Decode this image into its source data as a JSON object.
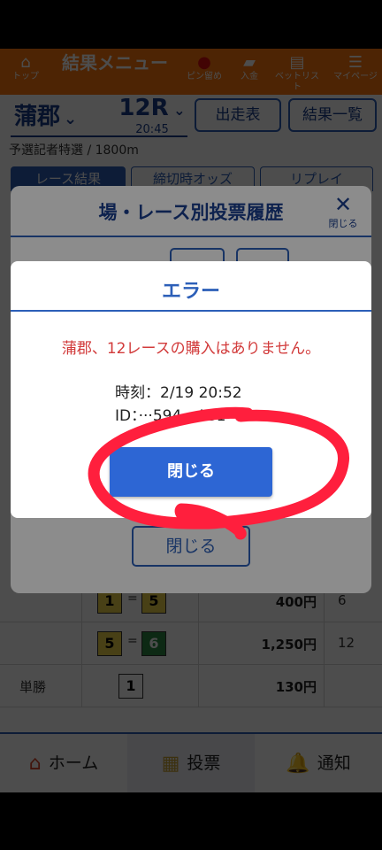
{
  "header": {
    "top_label": "トップ",
    "menu_title": "結果メニュー",
    "pin_label": "ピン留め",
    "deposit_label": "入金",
    "bet_list_label": "ベットリスト",
    "mypage_label": "マイページ"
  },
  "selector": {
    "venue": "蒲郡",
    "race": "12R",
    "time": "20:45",
    "entries_button": "出走表",
    "results_button": "結果一覧"
  },
  "race_info": {
    "subtitle": "予選記者特選 / 1800m"
  },
  "tabs": [
    {
      "label": "レース結果"
    },
    {
      "label": "締切時オッズ"
    },
    {
      "label": "リプレイ"
    }
  ],
  "results": {
    "rows": [
      {
        "label": "",
        "c1": "1",
        "c2": "5",
        "c1_color": "#f1d84a",
        "c2_color": "#f1d84a",
        "amount": "400円",
        "pop": "6"
      },
      {
        "label": "",
        "c1": "5",
        "c2": "6",
        "c1_color": "#f1d84a",
        "c2_color": "#2f8a45",
        "amount": "1,250円",
        "pop": "12"
      },
      {
        "label": "単勝",
        "c1": "1",
        "amount": "130円",
        "pop": ""
      }
    ],
    "eq_symbol": "="
  },
  "history_modal": {
    "title": "場・レース別投票履歴",
    "close_label": "閉じる",
    "close_button": "閉じる"
  },
  "error_modal": {
    "title": "エラー",
    "message": "蒲郡、12レースの購入はありません。",
    "time_line": "時刻：2/19 20:52",
    "id_line": "ID：···594 - A81",
    "ok_button": "閉じる"
  },
  "bottom_nav": [
    {
      "label": "ホーム"
    },
    {
      "label": "投票"
    },
    {
      "label": "通知"
    }
  ],
  "colors": {
    "brand_orange": "#ff7a0f",
    "primary_blue": "#2c5fb8",
    "error_red": "#d23b3b",
    "scribble_red": "#ff1f3d"
  }
}
